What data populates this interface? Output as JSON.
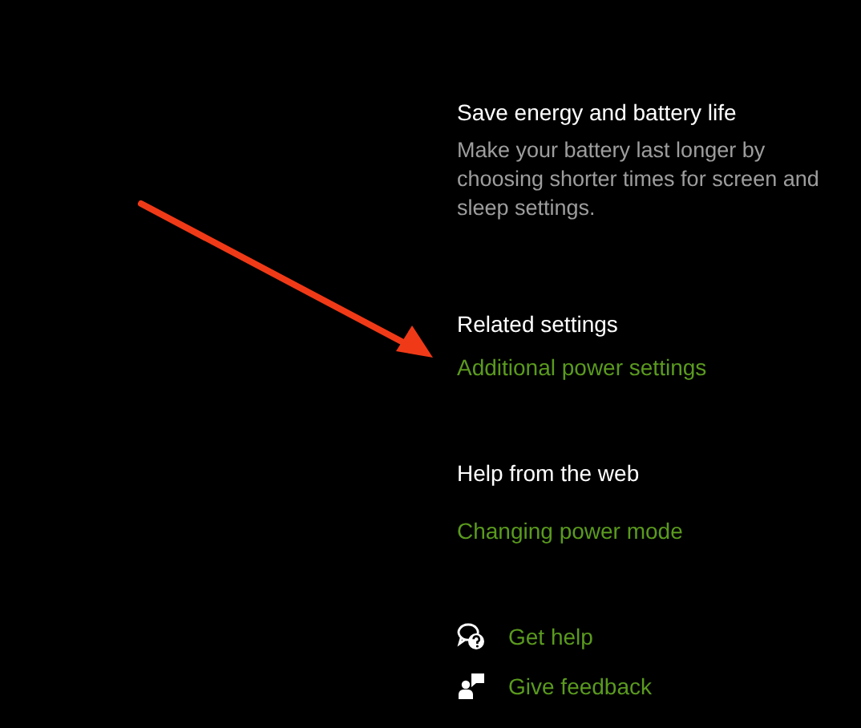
{
  "sections": [
    {
      "title": "Save energy and battery life",
      "description": "Make your battery last longer by choosing shorter times for screen and sleep settings."
    },
    {
      "title": "Related settings",
      "links": [
        "Additional power settings"
      ]
    },
    {
      "title": "Help from the web",
      "links": [
        "Changing power mode"
      ]
    }
  ],
  "actions": [
    {
      "kind": "help",
      "label": "Get help"
    },
    {
      "kind": "feedback",
      "label": "Give feedback"
    }
  ]
}
